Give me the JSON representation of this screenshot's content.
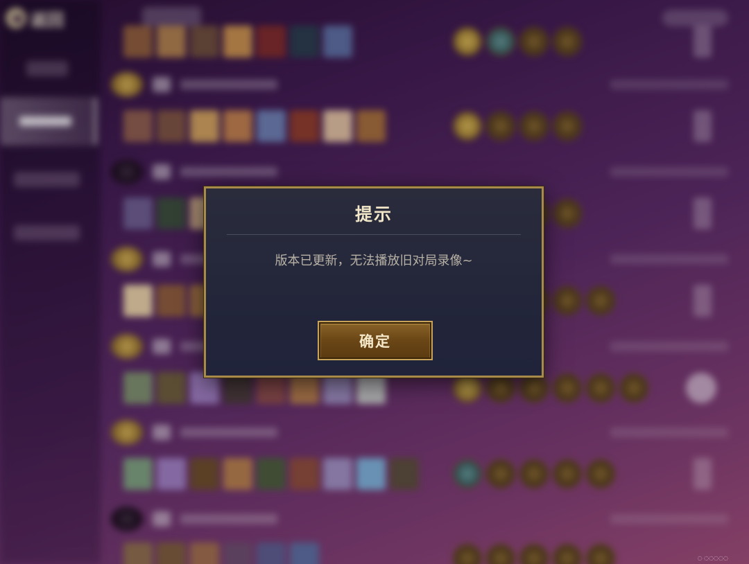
{
  "background": {
    "back_label": "返回"
  },
  "dialog": {
    "title": "提示",
    "message": "版本已更新，无法播放旧对局录像~",
    "confirm_label": "确定"
  },
  "colors": {
    "dialog_bg": "#252838",
    "dialog_border": "#a88a4a",
    "title_text": "#f2e6c8",
    "message_text": "#b8b2a6",
    "button_bg": "#6a4616",
    "button_border": "#c8a45a"
  }
}
